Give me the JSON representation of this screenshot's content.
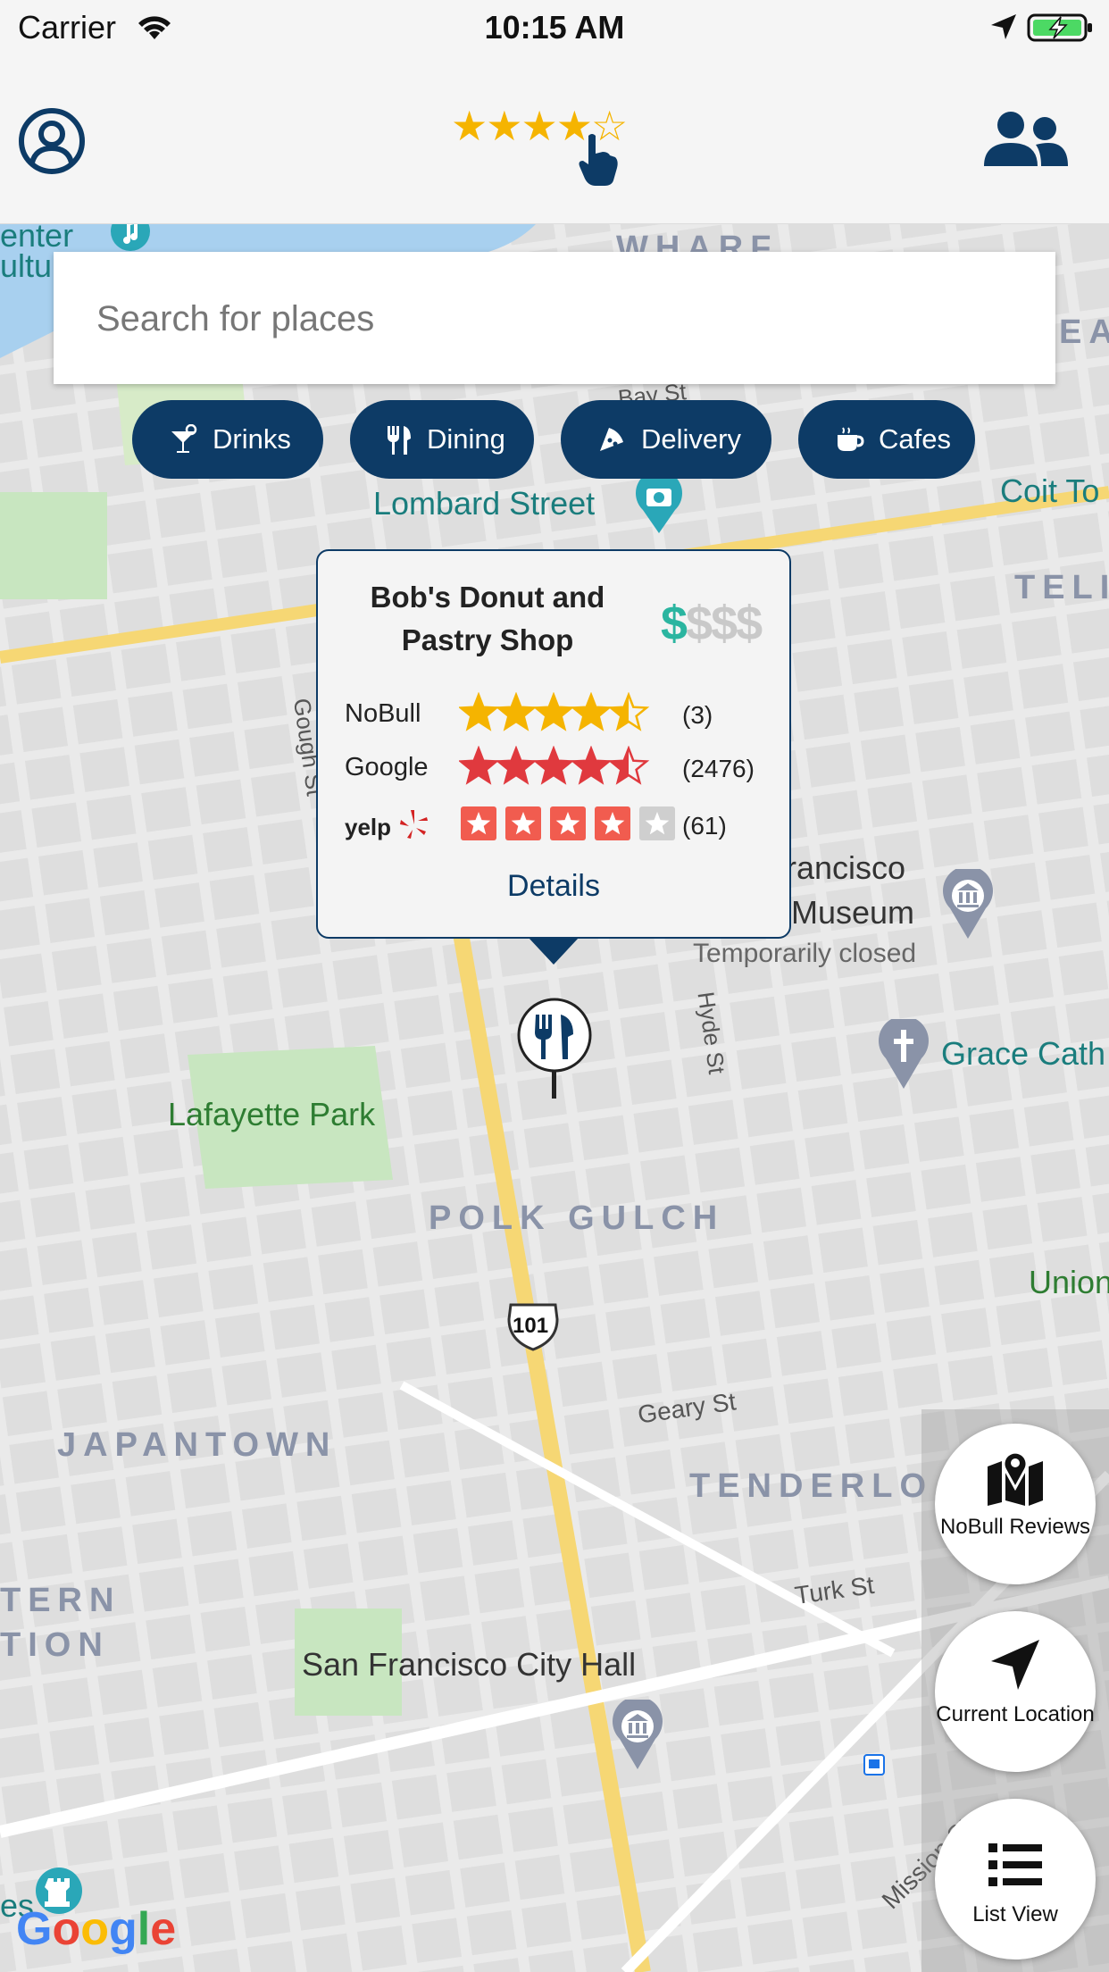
{
  "status_bar": {
    "carrier": "Carrier",
    "time": "10:15 AM"
  },
  "header": {
    "logo_stars": "★★★★☆"
  },
  "search": {
    "placeholder": "Search for places"
  },
  "filters": [
    {
      "label": "Drinks",
      "icon": "cocktail-icon"
    },
    {
      "label": "Dining",
      "icon": "utensils-icon"
    },
    {
      "label": "Delivery",
      "icon": "pizza-icon"
    },
    {
      "label": "Cafes",
      "icon": "coffee-icon"
    }
  ],
  "popup": {
    "title": "Bob's Donut and Pastry Shop",
    "price_level": 1,
    "price_symbols": "$$$$",
    "ratings": [
      {
        "source": "NoBull",
        "stars": 4.5,
        "count": "(3)",
        "color": "#f5b400"
      },
      {
        "source": "Google",
        "stars": 4.5,
        "count": "(2476)",
        "color": "#e0393e"
      },
      {
        "source": "yelp",
        "stars": 4,
        "count": "(61)",
        "color": "#f15c4f"
      }
    ],
    "details_label": "Details"
  },
  "map_labels": {
    "lombard": "Lombard Street",
    "coit": "Coit To",
    "wharf": "WHARF",
    "tel": "TELI",
    "ea": "EA",
    "francisco": "rancisco",
    "museum": "Museum",
    "temp_closed": "Temporarily closed",
    "grace": "Grace Cath",
    "gough": "Gough St",
    "hyde": "Hyde St",
    "lafayette": "Lafayette Park",
    "polk": "POLK GULCH",
    "union": "Union",
    "route": "101",
    "geary": "Geary St",
    "japantown": "JAPANTOWN",
    "tenderloin": "TENDERLO",
    "turk": "Turk St",
    "western1": "TERN",
    "western2": "TION",
    "city_hall": "San Francisco City Hall",
    "mission": "Mission St",
    "bay": "Bay St",
    "center1": "enter",
    "center2": "ultu",
    "es": "es"
  },
  "google_logo": [
    "G",
    "o",
    "o",
    "g",
    "l",
    "e"
  ],
  "fabs": [
    {
      "label": "NoBull Reviews",
      "icon": "map-marker-icon"
    },
    {
      "label": "Current Location",
      "icon": "location-arrow-icon"
    },
    {
      "label": "List View",
      "icon": "list-icon"
    }
  ],
  "colors": {
    "brand": "#0d3b66",
    "accent_gold": "#f5b400",
    "price_green": "#2bb5a0"
  }
}
